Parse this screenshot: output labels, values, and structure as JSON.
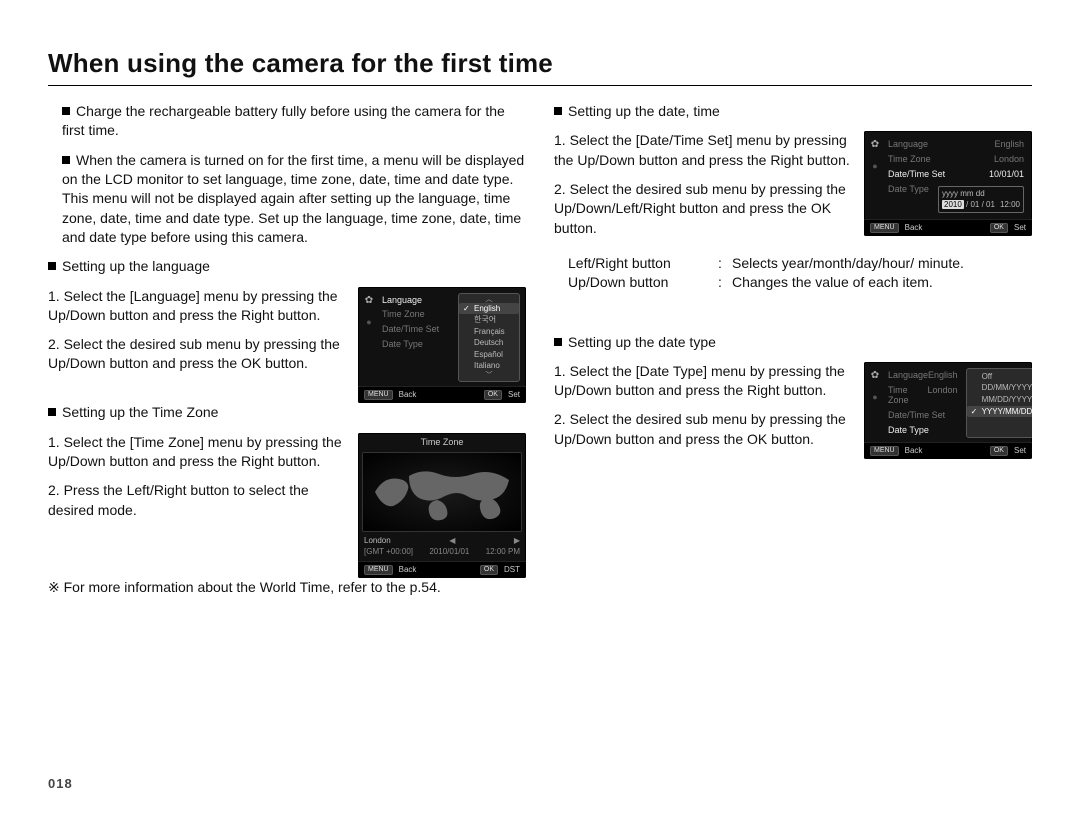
{
  "title": "When using the camera for the first time",
  "page_number": "018",
  "intro": {
    "bullet1": "Charge the rechargeable battery fully before using the camera for the first time.",
    "bullet2": "When the camera is turned on for the first time, a menu will be displayed on the LCD monitor to set language, time zone, date, time and date type. This menu will not be displayed again after setting up the language, time zone, date, time and date type. Set up the language, time zone, date, time and date type before using this camera."
  },
  "lang": {
    "title": "Setting up the language",
    "step1": "1. Select the [Language] menu by pressing the Up/Down button and press the Right button.",
    "step2": "2. Select the desired sub menu by pressing the Up/Down button and press the OK button.",
    "lcd": {
      "menu": {
        "language_label": "Language",
        "timezone_label": "Time Zone",
        "datetime_label": "Date/Time Set",
        "datetype_label": "Date Type"
      },
      "options": [
        "English",
        "한국어",
        "Français",
        "Deutsch",
        "Español",
        "Italiano"
      ],
      "selected": "English",
      "foot_back_tag": "MENU",
      "foot_back": "Back",
      "foot_set_tag": "OK",
      "foot_set": "Set"
    }
  },
  "tz": {
    "title": "Setting up the Time Zone",
    "step1": "1. Select the [Time Zone] menu by pressing the Up/Down button and press the Right button.",
    "step2": "2. Press the Left/Right button to select the desired mode.",
    "note": "※ For more information about the World Time, refer to the p.54.",
    "lcd": {
      "title": "Time Zone",
      "city": "London",
      "gmt": "[GMT +00:00]",
      "date": "2010/01/01",
      "time": "12:00 PM",
      "foot_back_tag": "MENU",
      "foot_back": "Back",
      "foot_set_tag": "OK",
      "foot_set": "DST"
    }
  },
  "dt": {
    "title": "Setting up the date, time",
    "step1": "1. Select the [Date/Time Set] menu by pressing the Up/Down button and press the Right button.",
    "step2": "2. Select the desired sub menu by pressing the Up/Down/Left/Right button and press the OK button.",
    "kv1_k": "Left/Right button",
    "kv1_v": "Selects year/month/day/hour/ minute.",
    "kv2_k": "Up/Down button",
    "kv2_v": "Changes the value of each item.",
    "lcd": {
      "menu": {
        "language_label": "Language",
        "language_val": "English",
        "timezone_label": "Time Zone",
        "timezone_val": "London",
        "datetime_label": "Date/Time Set",
        "datetime_val": "10/01/01",
        "datetype_label": "Date Type"
      },
      "fmt": "yyyy mm dd",
      "year_hl": "2010",
      "date_rest": "/ 01 / 01",
      "time": "12:00",
      "foot_back_tag": "MENU",
      "foot_back": "Back",
      "foot_set_tag": "OK",
      "foot_set": "Set"
    }
  },
  "dtype": {
    "title": "Setting up the date type",
    "step1": "1. Select the [Date Type] menu by pressing the Up/Down button and press the Right button.",
    "step2": "2. Select the desired sub menu by pressing the Up/Down button and press the OK button.",
    "lcd": {
      "menu": {
        "language_label": "Language",
        "language_val": "English",
        "timezone_label": "Time Zone",
        "timezone_val": "London",
        "datetime_label": "Date/Time Set",
        "datetype_label": "Date Type"
      },
      "options": [
        "Off",
        "DD/MM/YYYY",
        "MM/DD/YYYY",
        "YYYY/MM/DD"
      ],
      "selected": "YYYY/MM/DD",
      "foot_back_tag": "MENU",
      "foot_back": "Back",
      "foot_set_tag": "OK",
      "foot_set": "Set"
    }
  }
}
